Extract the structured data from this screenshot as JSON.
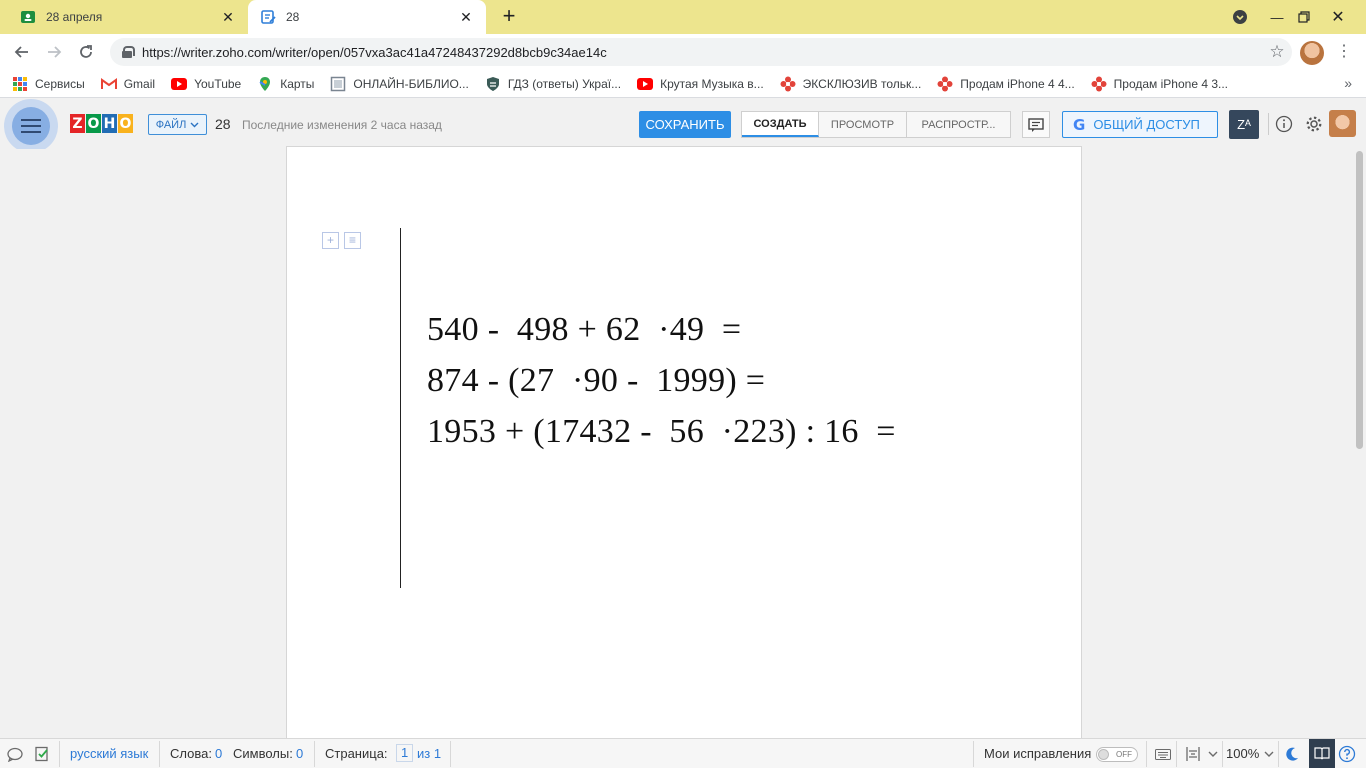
{
  "browser": {
    "tabs": [
      {
        "title": "28 апреля",
        "active": false,
        "icon": "classroom-icon"
      },
      {
        "title": "28",
        "active": true,
        "icon": "zoho-writer-icon"
      }
    ],
    "url": "https://writer.zoho.com/writer/open/057vxa3ac41a47248437292d8bcb9c34ae14c",
    "bookmarks": [
      {
        "label": "Сервисы",
        "icon": "apps-icon"
      },
      {
        "label": "Gmail",
        "icon": "gmail-icon"
      },
      {
        "label": "YouTube",
        "icon": "youtube-icon"
      },
      {
        "label": "Карты",
        "icon": "maps-icon"
      },
      {
        "label": "ОНЛАЙН-БИБЛИО...",
        "icon": "book-icon"
      },
      {
        "label": "ГДЗ (ответы) Украї...",
        "icon": "shield-icon"
      },
      {
        "label": "Крутая Музыка в...",
        "icon": "youtube-icon"
      },
      {
        "label": "ЭКСКЛЮЗИВ тольк...",
        "icon": "flower-icon"
      },
      {
        "label": "Продам iPhone 4 4...",
        "icon": "flower-icon"
      },
      {
        "label": "Продам iPhone 4 3...",
        "icon": "flower-icon"
      }
    ]
  },
  "header": {
    "file_label": "ФАЙЛ",
    "doc_name": "28",
    "last_modified": "Последние изменения 2 часа назад",
    "save_label": "СОХРАНИТЬ",
    "tabs": [
      "СОЗДАТЬ",
      "ПРОСМОТР",
      "РАСПРОСТР..."
    ],
    "share_label": "ОБЩИЙ ДОСТУП",
    "zoia_label": "Zᴬ"
  },
  "document": {
    "equations": [
      "540 -  498 + 62  ·49  =",
      "874 - (27  ·90 -  1999) =",
      "1953 + (17432 -  56  ·223) : 16  ="
    ]
  },
  "status": {
    "language": "русский язык",
    "words_label": "Слова:",
    "words_value": "0",
    "chars_label": "Символы:",
    "chars_value": "0",
    "page_label": "Страница:",
    "page_value": "1",
    "page_of": "из 1",
    "track_changes_label": "Мои исправления",
    "track_changes_state": "OFF",
    "zoom": "100%"
  }
}
